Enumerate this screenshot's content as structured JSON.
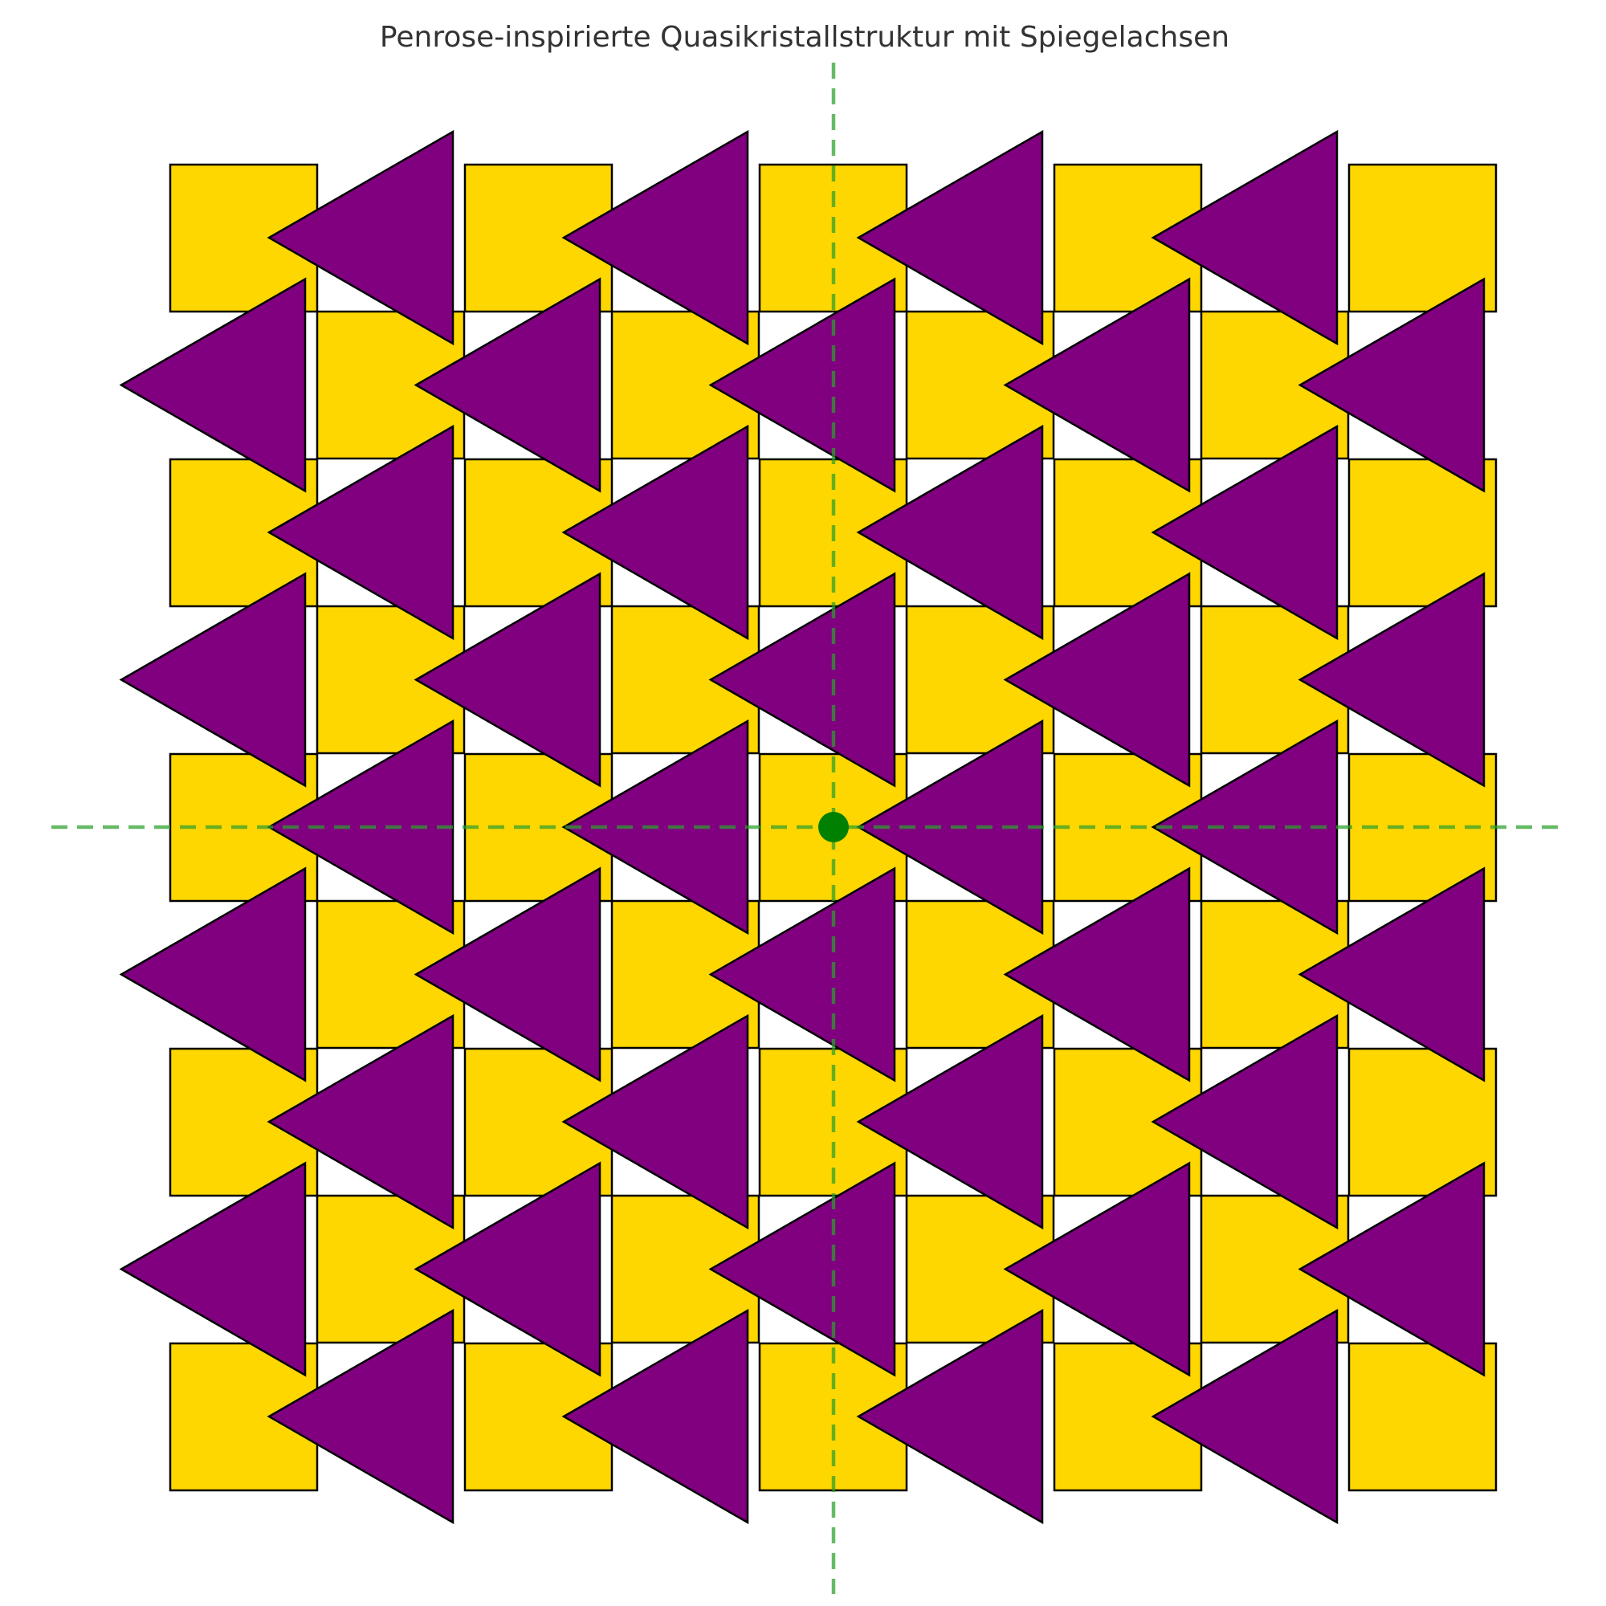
{
  "title": "Penrose-inspirierte Quasikristallstruktur mit Spiegelachsen",
  "colors": {
    "square_fill": "#FFD700",
    "triangle_fill": "#800080",
    "shape_stroke": "#000000",
    "axis": "#2ca02c",
    "center_point": "#008000",
    "title": "#333333",
    "background": "#ffffff"
  },
  "tiling": {
    "square_rows": 5,
    "squares_per_row": 5,
    "triangle_rows": 9,
    "triangles_odd_row": 4,
    "triangles_even_row": 5,
    "triangle_direction": "left"
  },
  "mirror_axes": [
    "vertical",
    "horizontal"
  ],
  "center_marker": true
}
